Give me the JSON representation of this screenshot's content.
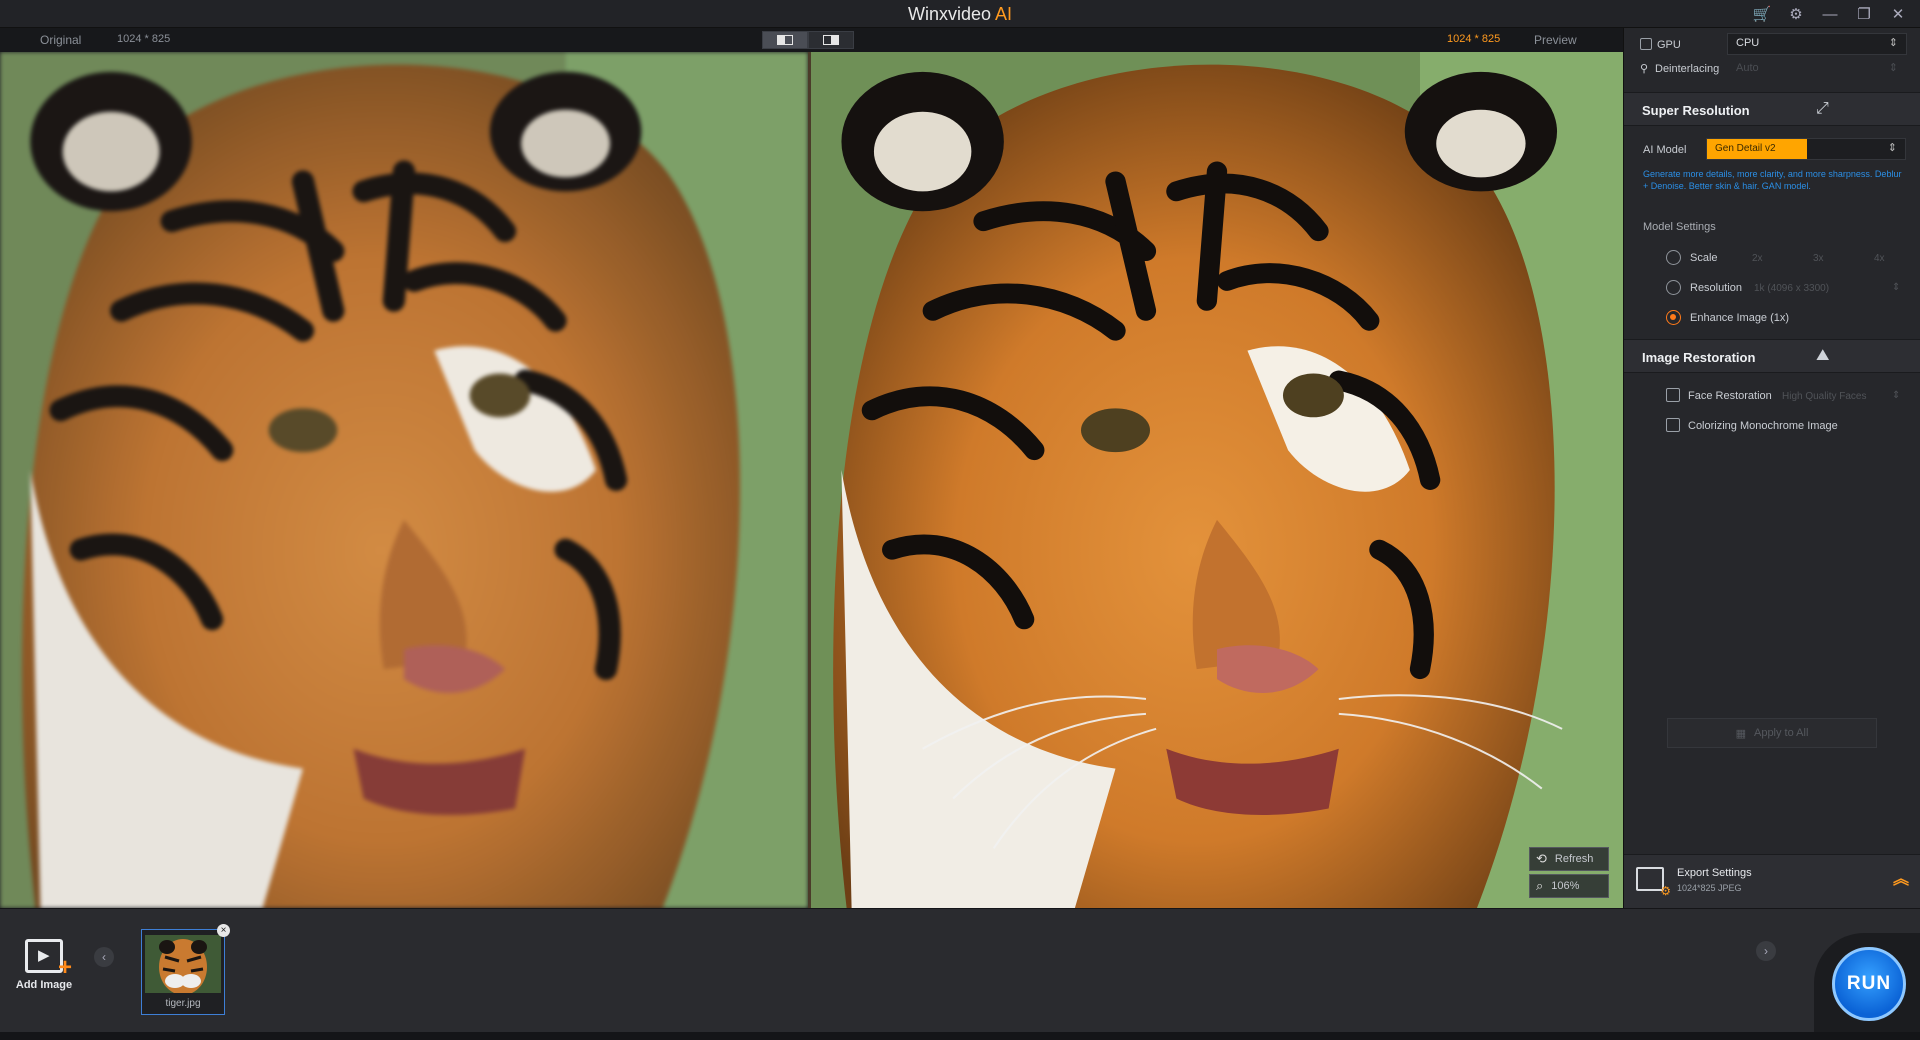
{
  "window": {
    "title": "Winxvideo",
    "title_suffix": "AI",
    "cart_icon": "cart-icon",
    "settings_icon": "gear-icon"
  },
  "compare": {
    "original_label": "Original",
    "original_resolution": "1024 * 825",
    "preview_resolution": "1024 * 825",
    "preview_label": "Preview",
    "preview_tools": {
      "refresh": "Refresh",
      "zoom": "106%"
    }
  },
  "panel": {
    "gpu_label": "GPU",
    "device_value": "CPU",
    "deinterlacing_label": "Deinterlacing",
    "deinterlacing_value": "Auto",
    "super_resolution_title": "Super Resolution",
    "ai_model_label": "AI Model",
    "ai_model_value": "Gen Detail v2",
    "ai_model_desc": "Generate more details, more clarity, and more sharpness. Deblur + Denoise. Better skin & hair. GAN model.",
    "model_settings_label": "Model Settings",
    "scale_label": "Scale",
    "scale_options": [
      "2x",
      "3x",
      "4x"
    ],
    "resolution_label": "Resolution",
    "resolution_value": "1k (4096 x 3300)",
    "enhance_label": "Enhance Image (1x)",
    "image_restoration_title": "Image Restoration",
    "face_restoration_label": "Face Restoration",
    "face_restoration_value": "High Quality Faces",
    "colorizing_label": "Colorizing Monochrome Image",
    "apply_all_label": "Apply to All",
    "export_title": "Export Settings",
    "export_detail": "1024*825  JPEG"
  },
  "bottom": {
    "add_image_label": "Add Image",
    "thumbnail_name": "tiger.jpg",
    "run_label": "RUN"
  },
  "colors": {
    "accent": "#ff9a1f",
    "model_highlight": "#ffa500",
    "description": "#2b8fe6",
    "run": "#0b63d6"
  }
}
